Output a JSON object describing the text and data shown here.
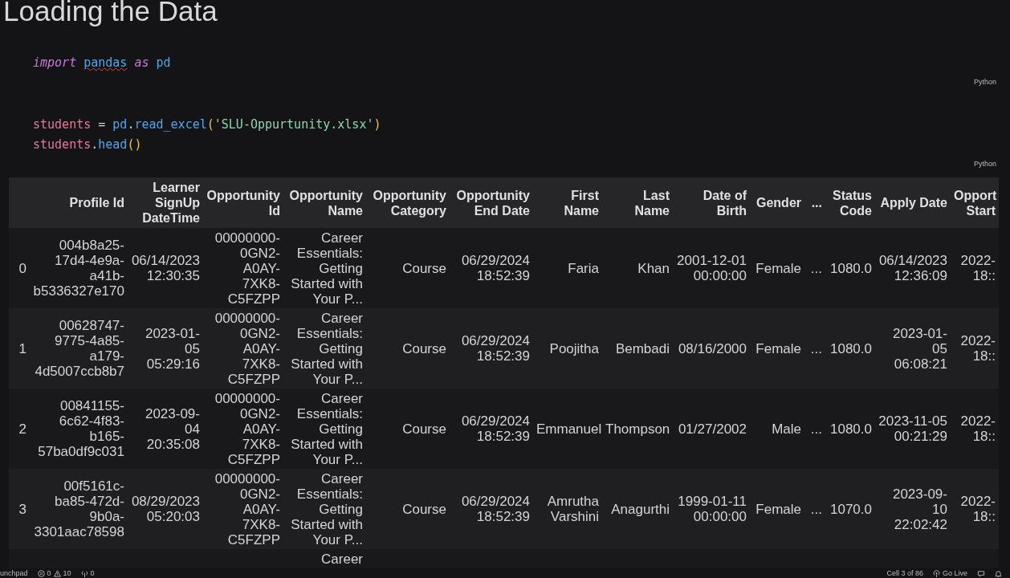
{
  "title": "Loading the Data",
  "cells": [
    {
      "language": "Python",
      "lines": [
        [
          [
            {
              "t": "import",
              "kind": "keyword"
            }
          ],
          [
            {
              "t": "pandas",
              "kind": "module",
              "squiggle": true
            }
          ],
          [
            {
              "t": "as",
              "kind": "keyword"
            }
          ],
          [
            {
              "t": "pd",
              "kind": "module",
              "squiggle": false
            }
          ]
        ]
      ]
    },
    {
      "language": "Python",
      "lines": [
        [
          [
            {
              "t": "students",
              "kind": "variable"
            }
          ],
          [
            {
              "t": "=",
              "kind": "plain"
            }
          ],
          [
            {
              "t": "pd",
              "kind": "module",
              "squiggle": false
            },
            {
              "t": ".",
              "kind": "plain"
            },
            {
              "t": "read_excel",
              "kind": "function"
            },
            {
              "t": "(",
              "kind": "bracket"
            },
            {
              "t": "'SLU-Oppurtunity.xlsx'",
              "kind": "string"
            },
            {
              "t": ")",
              "kind": "bracket"
            }
          ]
        ],
        [
          [
            {
              "t": "students",
              "kind": "variable"
            },
            {
              "t": ".",
              "kind": "plain"
            },
            {
              "t": "head",
              "kind": "function"
            },
            {
              "t": "()",
              "kind": "bracket"
            }
          ]
        ]
      ]
    }
  ],
  "table": {
    "columns": [
      "Profile Id",
      "Learner SignUp DateTime",
      "Opportunity Id",
      "Opportunity Name",
      "Opportunity Category",
      "Opportunity End Date",
      "First Name",
      "Last Name",
      "Date of Birth",
      "Gender",
      "...",
      "Status Code",
      "Apply Date",
      "Opport Start"
    ],
    "rows": [
      {
        "index": "0",
        "cells": [
          "004b8a25-17d4-4e9a-a41b-b5336327e170",
          "06/14/2023 12:30:35",
          "00000000-0GN2-A0AY-7XK8-C5FZPP",
          "Career Essentials: Getting Started with Your P...",
          "Course",
          "06/29/2024 18:52:39",
          "Faria",
          "Khan",
          "2001-12-01 00:00:00",
          "Female",
          "...",
          "1080.0",
          "06/14/2023 12:36:09",
          "2022- 18::"
        ]
      },
      {
        "index": "1",
        "cells": [
          "00628747-9775-4a85-a179-4d5007ccb8b7",
          "2023-01-05 05:29:16",
          "00000000-0GN2-A0AY-7XK8-C5FZPP",
          "Career Essentials: Getting Started with Your P...",
          "Course",
          "06/29/2024 18:52:39",
          "Poojitha",
          "Bembadi",
          "08/16/2000",
          "Female",
          "...",
          "1080.0",
          "2023-01-05 06:08:21",
          "2022- 18::"
        ]
      },
      {
        "index": "2",
        "cells": [
          "00841155-6c62-4f83-b165-57ba0df9c031",
          "2023-09-04 20:35:08",
          "00000000-0GN2-A0AY-7XK8-C5FZPP",
          "Career Essentials: Getting Started with Your P...",
          "Course",
          "06/29/2024 18:52:39",
          "Emmanuel",
          "Thompson",
          "01/27/2002",
          "Male",
          "...",
          "1080.0",
          "2023-11-05 00:21:29",
          "2022- 18::"
        ]
      },
      {
        "index": "3",
        "cells": [
          "00f5161c-ba85-472d-9b0a-3301aac78598",
          "08/29/2023 05:20:03",
          "00000000-0GN2-A0AY-7XK8-C5FZPP",
          "Career Essentials: Getting Started with Your P...",
          "Course",
          "06/29/2024 18:52:39",
          "Amrutha Varshini",
          "Anagurthi",
          "1999-01-11 00:00:00",
          "Female",
          "...",
          "1070.0",
          "2023-09-10 22:02:42",
          "2022- 18::"
        ]
      }
    ],
    "partial_row": {
      "opportunity_name": "Career"
    }
  },
  "status_bar": {
    "workspace": "unchpad",
    "errors": "0",
    "warnings": "10",
    "ports": "0",
    "cell": "Cell 3 of 86",
    "go_live": "Go Live"
  }
}
